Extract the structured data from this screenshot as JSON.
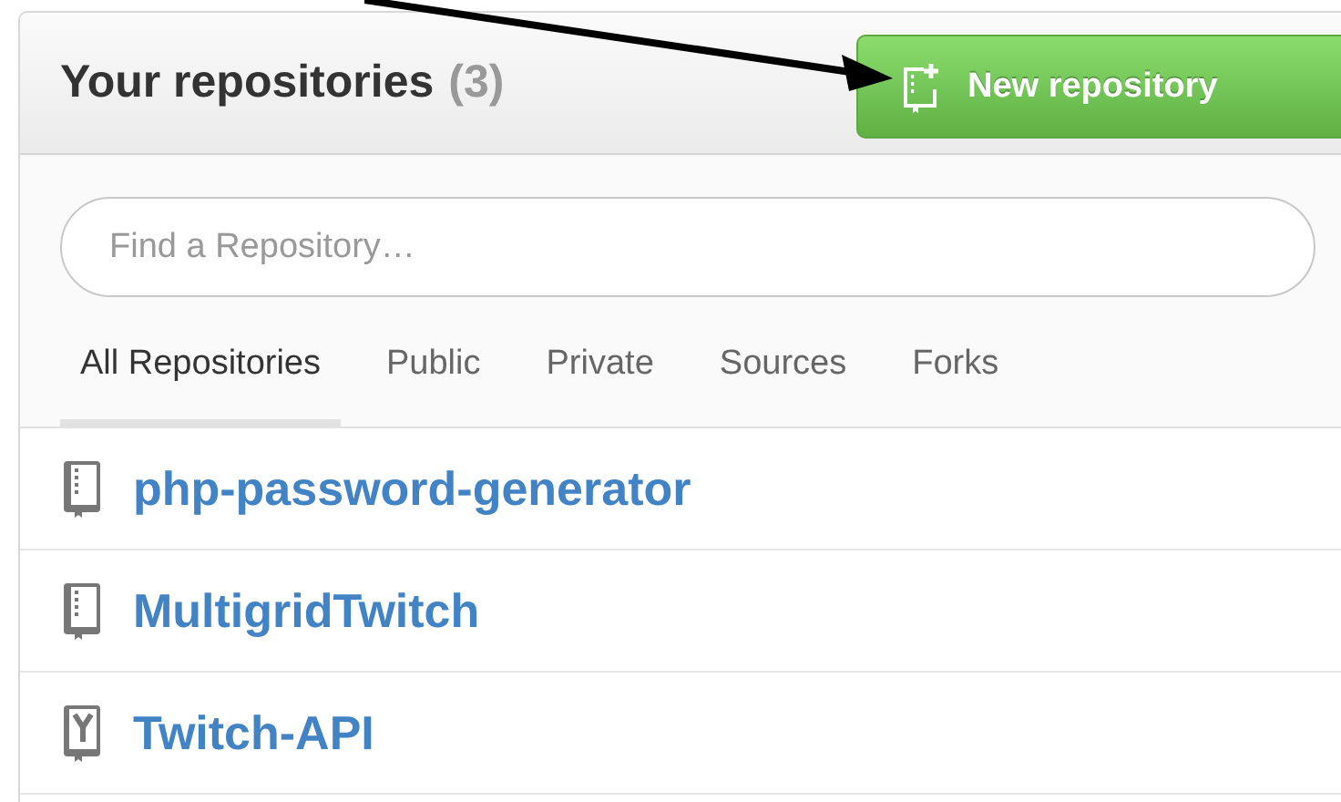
{
  "header": {
    "title": "Your repositories",
    "count": "(3)",
    "new_button": "New repository"
  },
  "search": {
    "placeholder": "Find a Repository…"
  },
  "tabs": [
    {
      "label": "All Repositories",
      "selected": true
    },
    {
      "label": "Public",
      "selected": false
    },
    {
      "label": "Private",
      "selected": false
    },
    {
      "label": "Sources",
      "selected": false
    },
    {
      "label": "Forks",
      "selected": false
    }
  ],
  "repositories": [
    {
      "name": "php-password-generator",
      "kind": "source"
    },
    {
      "name": "MultigridTwitch",
      "kind": "source"
    },
    {
      "name": "Twitch-API",
      "kind": "fork"
    }
  ]
}
